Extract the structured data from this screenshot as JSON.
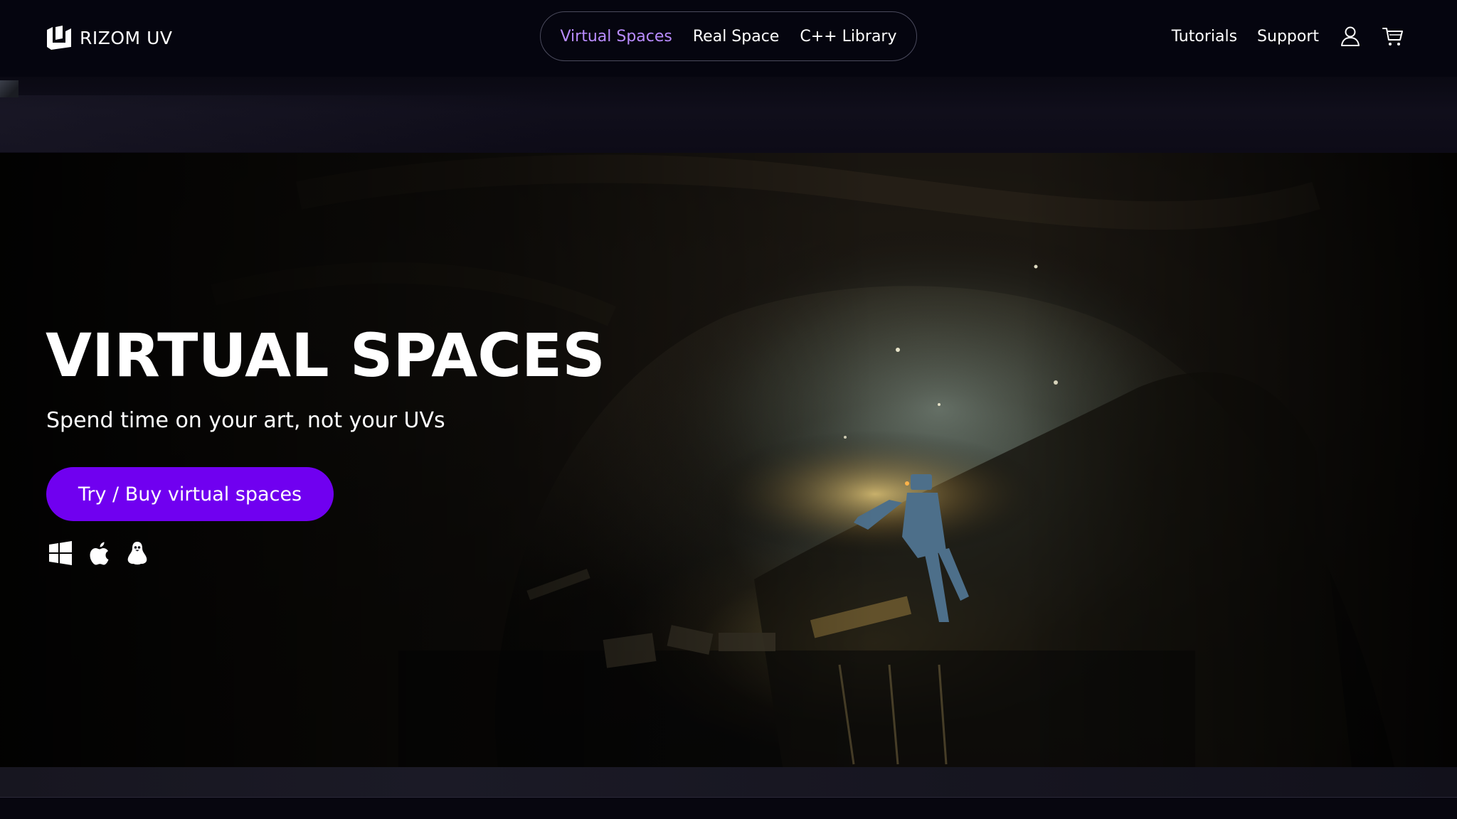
{
  "brand": {
    "name": "RIZOM UV",
    "logo_icon": "rizom-logo-icon"
  },
  "nav": {
    "center_links": [
      {
        "label": "Virtual Spaces",
        "active": true
      },
      {
        "label": "Real Space",
        "active": false
      },
      {
        "label": "C++ Library",
        "active": false
      }
    ],
    "right_links": [
      {
        "label": "Tutorials"
      },
      {
        "label": "Support"
      }
    ],
    "icons": [
      "user-icon",
      "cart-icon"
    ]
  },
  "hero": {
    "title": "VIRTUAL SPACES",
    "subtitle": "Spend time on your art, not your UVs",
    "cta_label": "Try / Buy virtual spaces",
    "platform_icons": [
      "windows-icon",
      "apple-icon",
      "linux-icon"
    ]
  },
  "colors": {
    "accent": "#7000f0",
    "active_link": "#b98cff",
    "background": "#05050f"
  }
}
